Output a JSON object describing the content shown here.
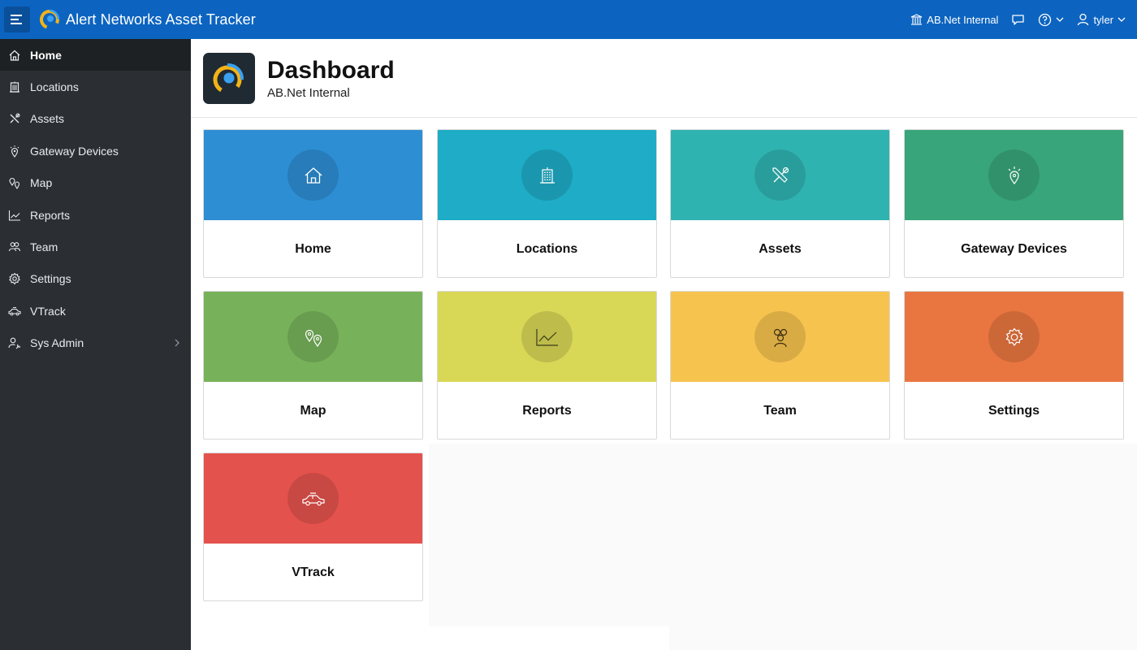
{
  "app": {
    "title": "Alert Networks Asset Tracker",
    "org": "AB.Net Internal",
    "user": "tyler",
    "header_color": "#0c64c0"
  },
  "sidebar": {
    "items": [
      {
        "label": "Home",
        "icon": "home-icon",
        "active": true
      },
      {
        "label": "Locations",
        "icon": "building-icon"
      },
      {
        "label": "Assets",
        "icon": "tools-icon"
      },
      {
        "label": "Gateway Devices",
        "icon": "gateway-icon"
      },
      {
        "label": "Map",
        "icon": "map-pins-icon"
      },
      {
        "label": "Reports",
        "icon": "line-chart-icon"
      },
      {
        "label": "Team",
        "icon": "users-icon"
      },
      {
        "label": "Settings",
        "icon": "gear-icon"
      },
      {
        "label": "VTrack",
        "icon": "vehicle-icon"
      },
      {
        "label": "Sys Admin",
        "icon": "user-wrench-icon",
        "has_children": true
      }
    ]
  },
  "page": {
    "title": "Dashboard",
    "subtitle": "AB.Net Internal"
  },
  "cards": [
    {
      "label": "Home",
      "color": "#2d8ed3",
      "icon": "home-icon"
    },
    {
      "label": "Locations",
      "color": "#1eacc6",
      "icon": "building-icon"
    },
    {
      "label": "Assets",
      "color": "#2fb3b1",
      "icon": "tools-icon"
    },
    {
      "label": "Gateway Devices",
      "color": "#38a57a",
      "icon": "gateway-icon"
    },
    {
      "label": "Map",
      "color": "#77b25a",
      "icon": "map-pins-icon"
    },
    {
      "label": "Reports",
      "color": "#d9d756",
      "icon": "line-chart-icon"
    },
    {
      "label": "Team",
      "color": "#f7c34f",
      "icon": "users-icon"
    },
    {
      "label": "Settings",
      "color": "#e97640",
      "icon": "gear-icon"
    },
    {
      "label": "VTrack",
      "color": "#e4524d",
      "icon": "vehicle-icon"
    }
  ]
}
